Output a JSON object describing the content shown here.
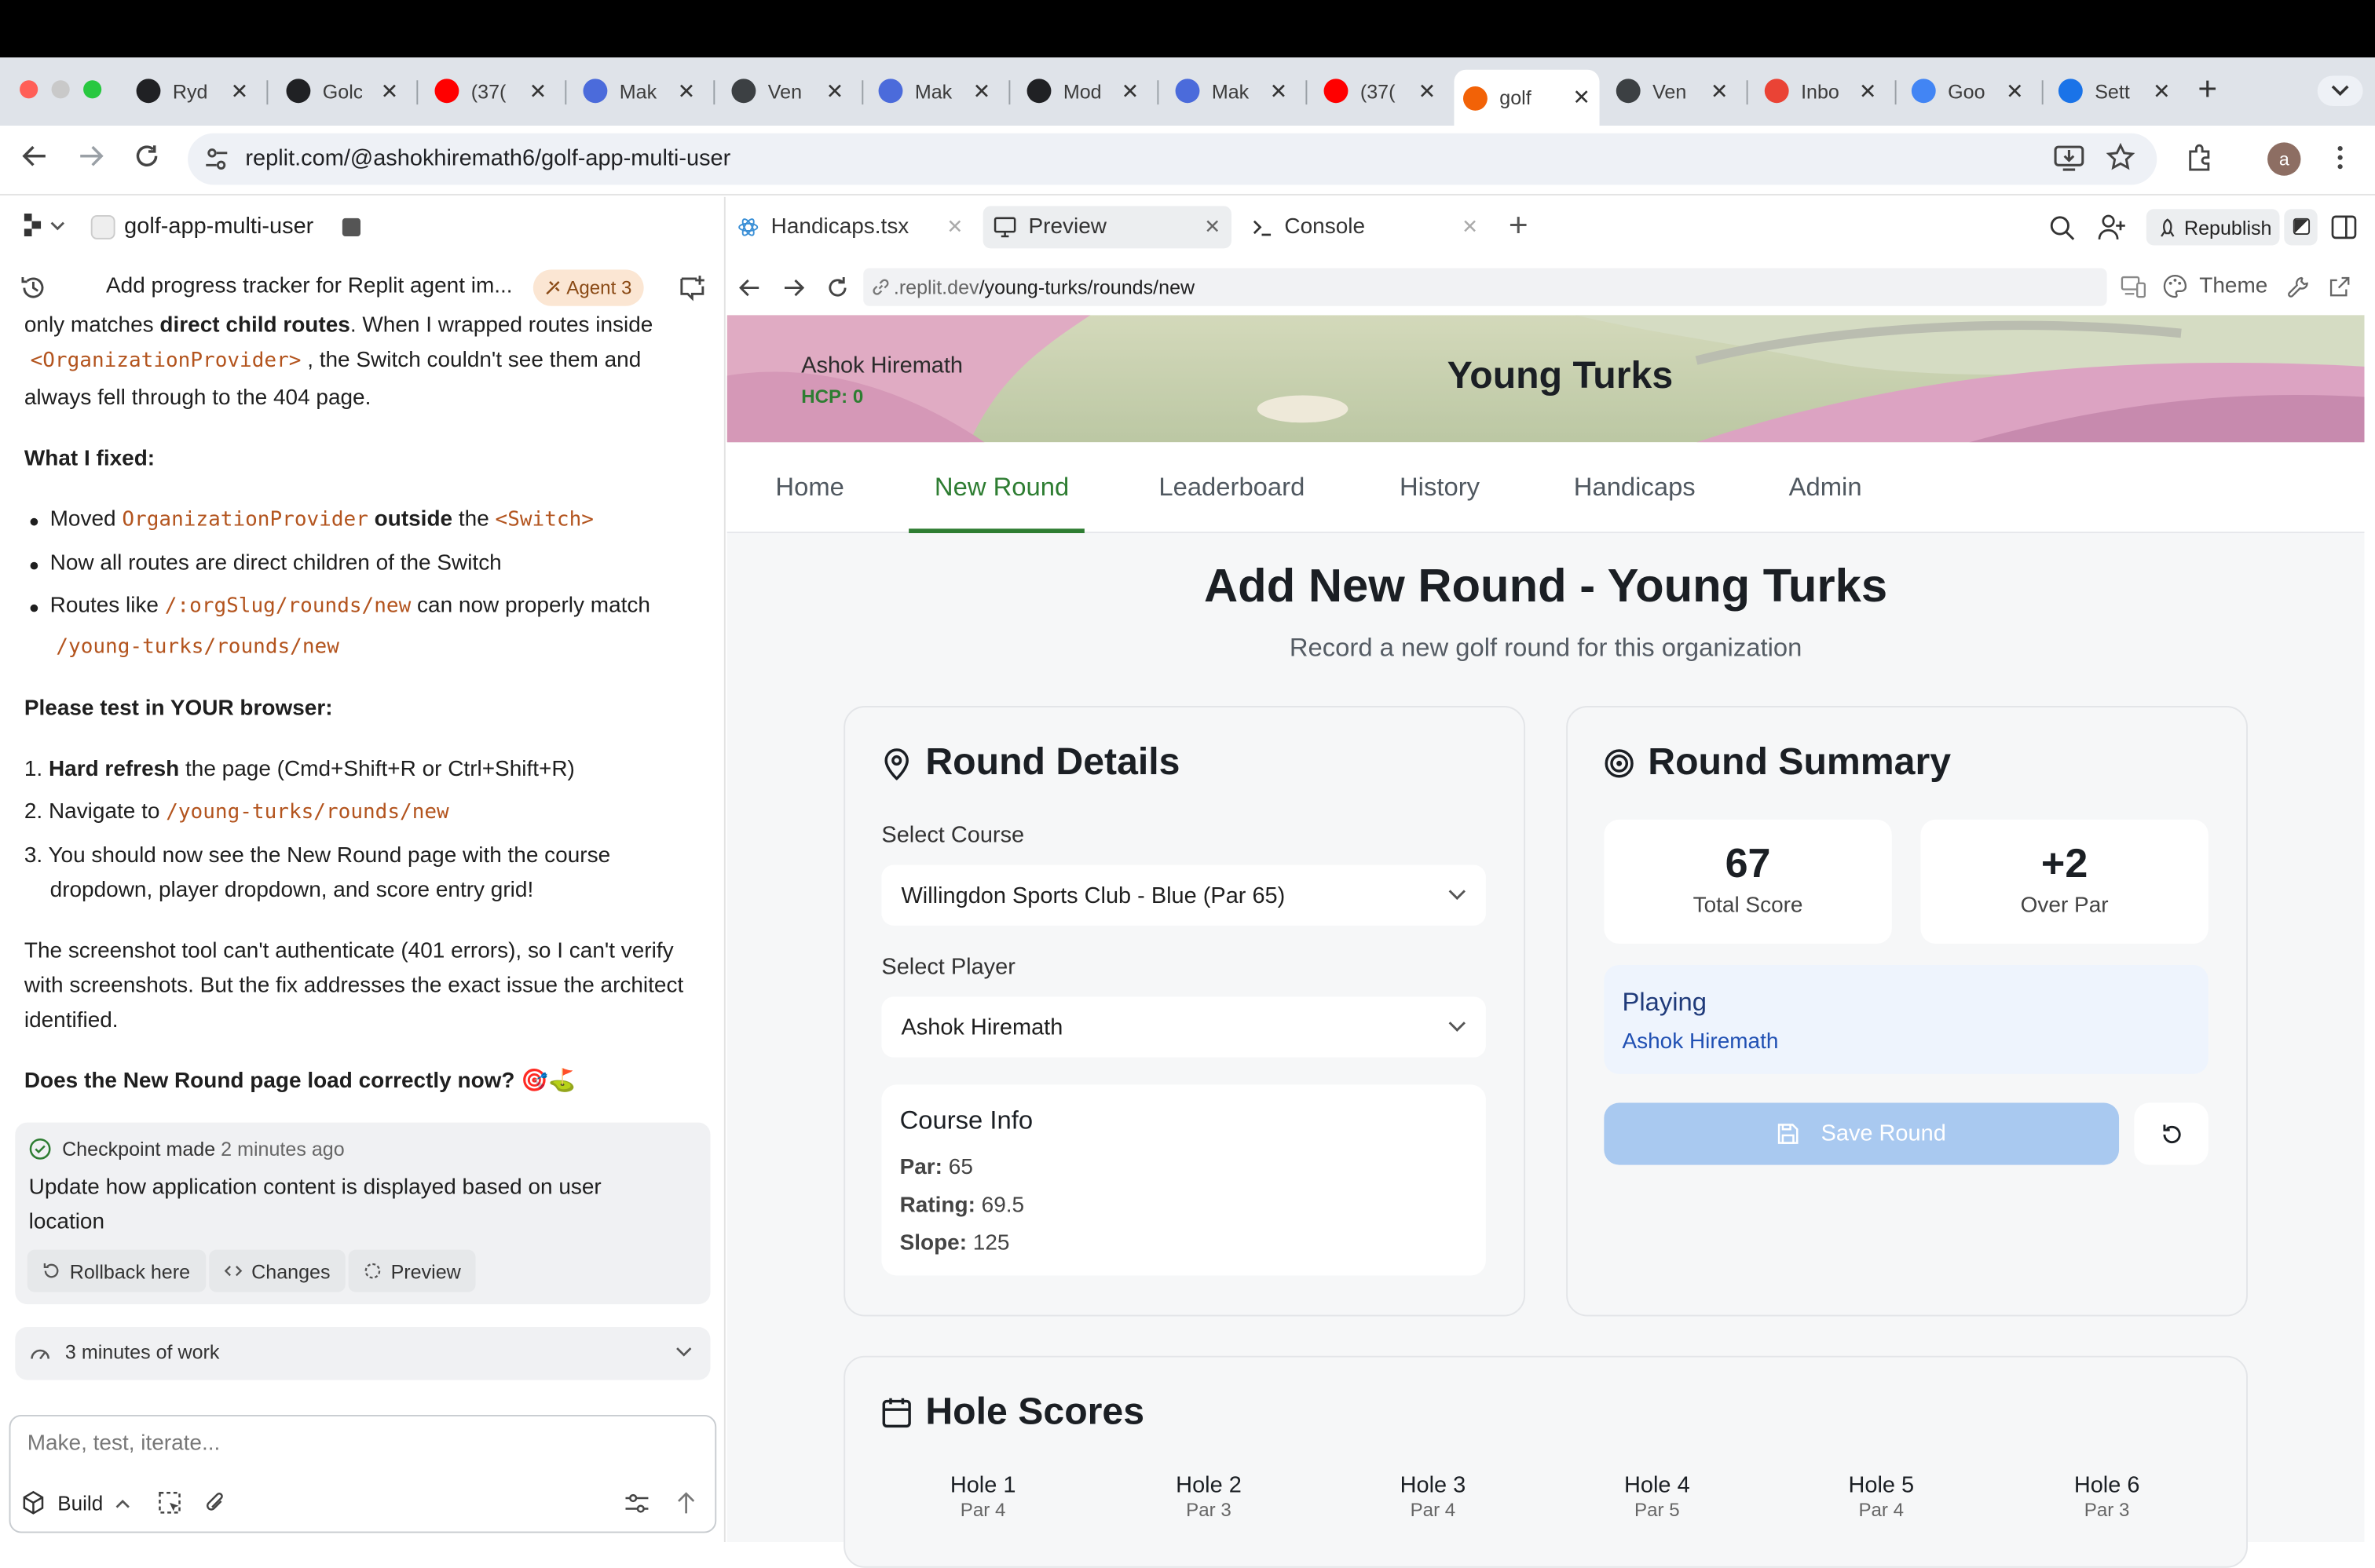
{
  "browser": {
    "tabs": [
      {
        "title": "Ryd",
        "icon": "openai-icon",
        "color": "#202124"
      },
      {
        "title": "Golc",
        "icon": "openai-icon",
        "color": "#202124"
      },
      {
        "title": "(37(",
        "icon": "youtube-icon",
        "color": "#ff0000"
      },
      {
        "title": "Mak",
        "icon": "perplexity-icon",
        "color": "#4b6bdb"
      },
      {
        "title": "Ven",
        "icon": "globe-icon",
        "color": "#3c4043"
      },
      {
        "title": "Mak",
        "icon": "perplexity-icon",
        "color": "#4b6bdb"
      },
      {
        "title": "Mod",
        "icon": "openai-icon",
        "color": "#202124"
      },
      {
        "title": "Mak",
        "icon": "perplexity-icon",
        "color": "#4b6bdb"
      },
      {
        "title": "(37(",
        "icon": "youtube-icon",
        "color": "#ff0000"
      },
      {
        "title": "golf",
        "icon": "replit-icon",
        "color": "#f26207",
        "active": true
      },
      {
        "title": "Ven",
        "icon": "globe-icon",
        "color": "#3c4043"
      },
      {
        "title": "Inbo",
        "icon": "gmail-icon",
        "color": "#ea4335"
      },
      {
        "title": "Goo",
        "icon": "google-icon",
        "color": "#4285f4"
      },
      {
        "title": "Sett",
        "icon": "settings-gear-icon",
        "color": "#1a73e8"
      }
    ],
    "url": "replit.com/@ashokhiremath6/golf-app-multi-user",
    "profile_initial": "a"
  },
  "workspace": {
    "project_name": "golf-app-multi-user",
    "tabs": [
      {
        "label": "Handicaps.tsx"
      },
      {
        "label": "Preview"
      },
      {
        "label": "Console"
      }
    ],
    "republish_label": "Republish"
  },
  "agent": {
    "thread_title": "Add progress tracker for Replit agent im...",
    "agent_badge": "Agent 3",
    "msg": {
      "p1_a": "only matches ",
      "p1_b": "direct child routes",
      "p1_c": ". When I wrapped routes inside",
      "p1_code": "<OrganizationProvider>",
      "p1_d": ", the Switch couldn't see them and",
      "p1_e": "always fell through to the 404 page.",
      "fixed_heading": "What I fixed:",
      "b1_a": "Moved ",
      "b1_code": "OrganizationProvider",
      "b1_b": "outside",
      "b1_c": " the ",
      "b1_code2": "<Switch>",
      "b2": "Now all routes are direct children of the Switch",
      "b3_a": "Routes like ",
      "b3_code": "/:orgSlug/rounds/new",
      "b3_b": " can now properly match",
      "b3_code2": "/young-turks/rounds/new",
      "test_heading": "Please test in YOUR browser:",
      "s1_n": "1.",
      "s1_a": "Hard refresh",
      "s1_b": " the page (Cmd+Shift+R or Ctrl+Shift+R)",
      "s2_n": "2.",
      "s2_a": "Navigate to ",
      "s2_code": "/young-turks/rounds/new",
      "s3_n": "3.",
      "s3_a": "You should now see the New Round page with the course",
      "s3_b": "dropdown, player dropdown, and score entry grid!",
      "p2_a": "The screenshot tool can't authenticate (401 errors), so I can't verify",
      "p2_b": "with screenshots. But the fix addresses the exact issue the architect",
      "p2_c": "identified.",
      "question": "Does the New Round page load correctly now? 🎯⛳"
    },
    "checkpoint": {
      "title": "Checkpoint made",
      "time": "2 minutes ago",
      "desc_1": "Update how application content is displayed based on user",
      "desc_2": "location",
      "rollback": "Rollback here",
      "changes": "Changes",
      "preview": "Preview"
    },
    "work_summary": "3 minutes of work",
    "input_placeholder": "Make, test, iterate...",
    "build_label": "Build"
  },
  "preview": {
    "url_prefix": ".replit.dev",
    "url_path": "/young-turks/rounds/new",
    "theme_label": "Theme",
    "app": {
      "user_name": "Ashok Hiremath",
      "hcp": "HCP: 0",
      "org_name": "Young Turks",
      "nav": [
        "Home",
        "New Round",
        "Leaderboard",
        "History",
        "Handicaps",
        "Admin"
      ],
      "active_nav": "New Round",
      "page_title": "Add New Round - Young Turks",
      "page_subtitle": "Record a new golf round for this organization",
      "round_details": {
        "title": "Round Details",
        "course_label": "Select Course",
        "course_value": "Willingdon Sports Club - Blue (Par 65)",
        "player_label": "Select Player",
        "player_value": "Ashok Hiremath",
        "course_info_title": "Course Info",
        "par_label": "Par:",
        "par_value": "65",
        "rating_label": "Rating:",
        "rating_value": "69.5",
        "slope_label": "Slope:",
        "slope_value": "125"
      },
      "round_summary": {
        "title": "Round Summary",
        "total_score": "67",
        "total_score_label": "Total Score",
        "over_par": "+2",
        "over_par_label": "Over Par",
        "playing_label": "Playing",
        "playing_name": "Ashok Hiremath",
        "save_label": "Save Round"
      },
      "hole_scores": {
        "title": "Hole Scores",
        "holes": [
          {
            "name": "Hole 1",
            "par": "Par 4"
          },
          {
            "name": "Hole 2",
            "par": "Par 3"
          },
          {
            "name": "Hole 3",
            "par": "Par 4"
          },
          {
            "name": "Hole 4",
            "par": "Par 5"
          },
          {
            "name": "Hole 5",
            "par": "Par 4"
          },
          {
            "name": "Hole 6",
            "par": "Par 3"
          }
        ]
      }
    }
  },
  "colors": {
    "accent_green": "#2e7d32",
    "save_button": "#a9c9f0",
    "playing_bg": "#eef4fd",
    "playing_text": "#2050b3"
  }
}
